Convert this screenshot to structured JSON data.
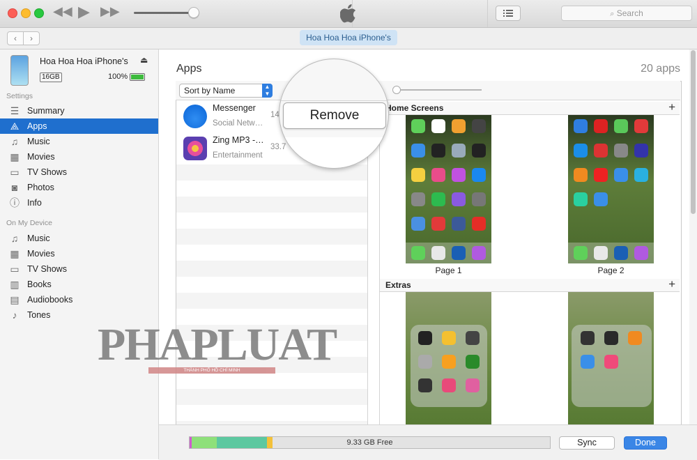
{
  "window": {
    "device_tab": "Hoa Hoa Hoa iPhone's",
    "search_placeholder": "Search",
    "volume_level": 0.9
  },
  "device": {
    "name": "Hoa Hoa Hoa iPhone's",
    "capacity": "16GB",
    "battery": "100%"
  },
  "sidebar": {
    "settings_header": "Settings",
    "settings_items": [
      {
        "label": "Summary",
        "icon": "list-icon"
      },
      {
        "label": "Apps",
        "icon": "app-store-icon",
        "selected": true
      },
      {
        "label": "Music",
        "icon": "music-note-icon"
      },
      {
        "label": "Movies",
        "icon": "film-icon"
      },
      {
        "label": "TV Shows",
        "icon": "tv-icon"
      },
      {
        "label": "Photos",
        "icon": "camera-icon"
      },
      {
        "label": "Info",
        "icon": "info-icon"
      }
    ],
    "device_header": "On My Device",
    "device_items": [
      {
        "label": "Music",
        "icon": "music-note-icon"
      },
      {
        "label": "Movies",
        "icon": "film-icon"
      },
      {
        "label": "TV Shows",
        "icon": "tv-icon"
      },
      {
        "label": "Books",
        "icon": "book-icon"
      },
      {
        "label": "Audiobooks",
        "icon": "audiobook-icon"
      },
      {
        "label": "Tones",
        "icon": "bell-icon"
      }
    ]
  },
  "main": {
    "title": "Apps",
    "count": "20 apps",
    "sort_label": "Sort by Name",
    "remove_label": "Remove",
    "apps": [
      {
        "name": "Messenger",
        "category": "Social Netw…",
        "size": "14",
        "icon": "messenger-icon"
      },
      {
        "name": "Zing MP3 -…",
        "category": "Entertainment",
        "size": "33.7",
        "icon": "zing-mp3-icon"
      }
    ],
    "home_screens_label": "Home Screens",
    "extras_label": "Extras",
    "pages": [
      "Page 1",
      "Page 2"
    ],
    "colors": {
      "accent": "#1f6fce",
      "done_button": "#3a86e6"
    }
  },
  "storage": {
    "free_label": "9.33 GB Free",
    "segments": [
      {
        "name": "other",
        "color": "#d05ad0",
        "fraction": 0.006
      },
      {
        "name": "photos",
        "color": "#8ee07a",
        "fraction": 0.07
      },
      {
        "name": "apps",
        "color": "#5dc8a0",
        "fraction": 0.14
      },
      {
        "name": "documents",
        "color": "#f3c13a",
        "fraction": 0.016
      }
    ]
  },
  "actions": {
    "sync_label": "Sync",
    "done_label": "Done"
  },
  "watermark": {
    "brand": "PHAPLUAT",
    "sub": "THÀNH PHỐ HỒ CHÍ MINH"
  }
}
